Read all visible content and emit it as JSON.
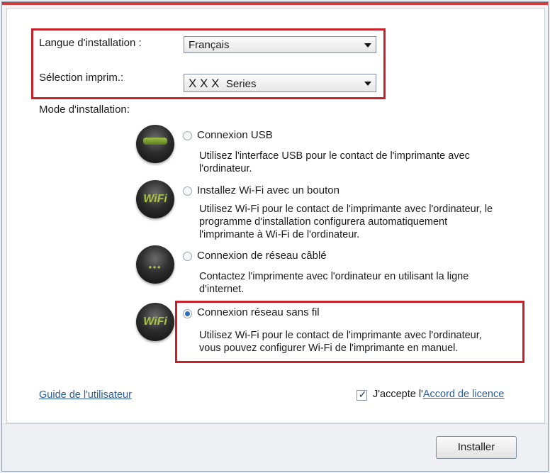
{
  "installation": {
    "language_label": "Langue d'installation :",
    "language_value": "Français",
    "printer_label": "Sélection imprim.:",
    "printer_value_prefix": "X X X",
    "printer_value_suffix": "Series",
    "mode_label": "Mode d'installation:"
  },
  "options": [
    {
      "label": "Connexion USB",
      "desc_lines": [
        "Utilisez  l'interface USB pour le contact de l'imprimante  avec",
        "l'ordinateur."
      ],
      "icon": "usb-icon",
      "selected": false
    },
    {
      "label": "Installez Wi-Fi avec un bouton",
      "desc_lines": [
        "Utilisez Wi-Fi pour le contact de l'imprimante avec l'ordinateur, le",
        "programme d'installation configurera automatiquement",
        "l'imprimante  à Wi-Fi de l'ordinateur."
      ],
      "icon": "wifi-icon",
      "icon_text": "WiFi",
      "selected": false
    },
    {
      "label": "Connexion de réseau câblé",
      "desc_lines": [
        "Contactez l'imprimente avec l'ordinateur en utilisant la ligne",
        "d'internet."
      ],
      "icon": "wired-network-icon",
      "selected": false
    },
    {
      "label": "Connexion réseau sans fil",
      "desc_lines": [
        "Utilisez Wi-Fi pour le contact de l'imprimante avec l'ordinateur,",
        "vous pouvez configurer Wi-Fi de l'imprimante en manuel."
      ],
      "icon": "wifi-icon",
      "icon_text": "WiFi",
      "selected": true
    }
  ],
  "footer": {
    "user_guide_link": "Guide de l'utilisateur",
    "accept_text": "J'accepte l'",
    "license_link": "Accord de licence",
    "accept_checked": true,
    "install_button": "Installer"
  },
  "colors": {
    "highlight": "#c9202a",
    "link": "#2a5d97",
    "icon_green": "#a7c43f"
  }
}
